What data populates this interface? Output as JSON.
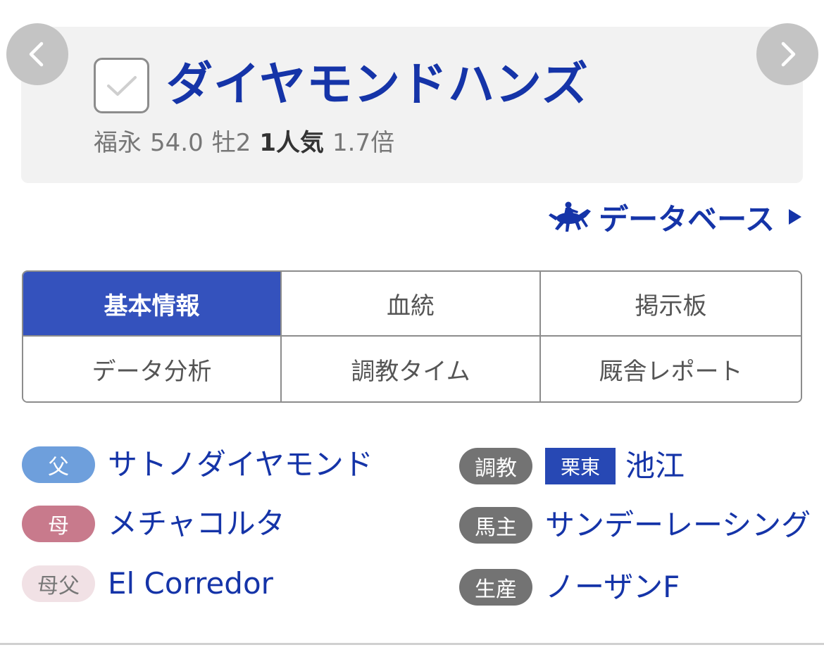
{
  "horse": {
    "name": "ダイヤモンドハンズ",
    "jockey": "福永",
    "weight": "54.0",
    "sex_age": "牡2",
    "popularity": "1人気",
    "odds": "1.7倍"
  },
  "database_link": {
    "label": "データベース"
  },
  "tabs": [
    {
      "label": "基本情報",
      "active": true
    },
    {
      "label": "血統",
      "active": false
    },
    {
      "label": "掲示板",
      "active": false
    },
    {
      "label": "データ分析",
      "active": false
    },
    {
      "label": "調教タイム",
      "active": false
    },
    {
      "label": "厩舎レポート",
      "active": false
    }
  ],
  "pedigree": {
    "father": {
      "tag": "父",
      "value": "サトノダイヤモンド"
    },
    "mother": {
      "tag": "母",
      "value": "メチャコルタ"
    },
    "mother_father": {
      "tag": "母父",
      "value": "El Corredor"
    }
  },
  "details": {
    "trainer": {
      "tag": "調教",
      "region": "栗東",
      "value": "池江"
    },
    "owner": {
      "tag": "馬主",
      "value": "サンデーレーシング"
    },
    "breeder": {
      "tag": "生産",
      "value": "ノーザンF"
    }
  },
  "colors": {
    "accent": "#1534a8",
    "tab_active": "#3452bd",
    "father_pill": "#6e9fdc",
    "mother_pill": "#c87a8c",
    "mother_father_pill": "#f1e1e5",
    "label_pill": "#737373"
  },
  "icons": {
    "prev": "chevron-left-icon",
    "next": "chevron-right-icon",
    "check": "check-icon",
    "database": "jockey-horse-icon",
    "arrow": "triangle-right-icon"
  }
}
